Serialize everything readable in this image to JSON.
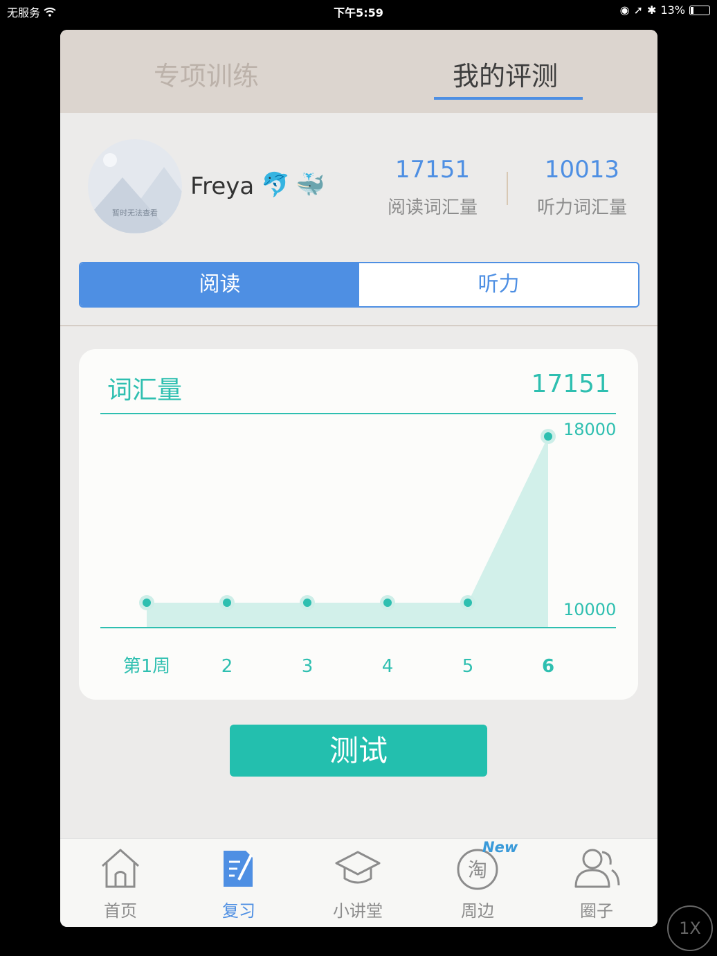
{
  "status_bar": {
    "carrier": "无服务",
    "time": "下午5:59",
    "battery": "13%"
  },
  "tabs": [
    {
      "label": "专项训练",
      "active": false
    },
    {
      "label": "我的评测",
      "active": true
    }
  ],
  "profile": {
    "name": "Freya",
    "emoji_1": "🐬",
    "emoji_2": "🐳",
    "avatar_caption": "暂时无法查看",
    "reading_vocab": "17151",
    "reading_vocab_label": "阅读词汇量",
    "listening_vocab": "10013",
    "listening_vocab_label": "听力词汇量"
  },
  "segment": {
    "options": [
      "阅读",
      "听力"
    ],
    "selected": "阅读"
  },
  "card": {
    "title": "词汇量",
    "value": "17151"
  },
  "chart_data": {
    "type": "area",
    "categories": [
      "第1周",
      "2",
      "3",
      "4",
      "5",
      "6"
    ],
    "values": [
      10000,
      10000,
      10000,
      10000,
      10000,
      18000
    ],
    "y_tick_labels": [
      "10000",
      "18000"
    ],
    "ylim": [
      10000,
      18000
    ],
    "grid": false,
    "colors": {
      "line": "#2ebfb0",
      "fill": "#cdeee8",
      "text": "#2ebfb0"
    }
  },
  "test_button": {
    "label": "测试"
  },
  "bottom_nav": {
    "items": [
      {
        "label": "首页",
        "icon": "home-icon",
        "active": false
      },
      {
        "label": "复习",
        "icon": "review-icon",
        "active": true
      },
      {
        "label": "小讲堂",
        "icon": "graduation-cap-icon",
        "active": false
      },
      {
        "label": "周边",
        "icon": "taobao-icon",
        "icon_text": "淘",
        "active": false
      },
      {
        "label": "圈子",
        "icon": "people-icon",
        "active": false
      }
    ],
    "new_badge": "New"
  },
  "zoom_button": {
    "label": "1X"
  },
  "colors": {
    "accent_blue": "#4e8fe3",
    "teal": "#23bfae",
    "tab_bg": "#dcd5cf"
  }
}
